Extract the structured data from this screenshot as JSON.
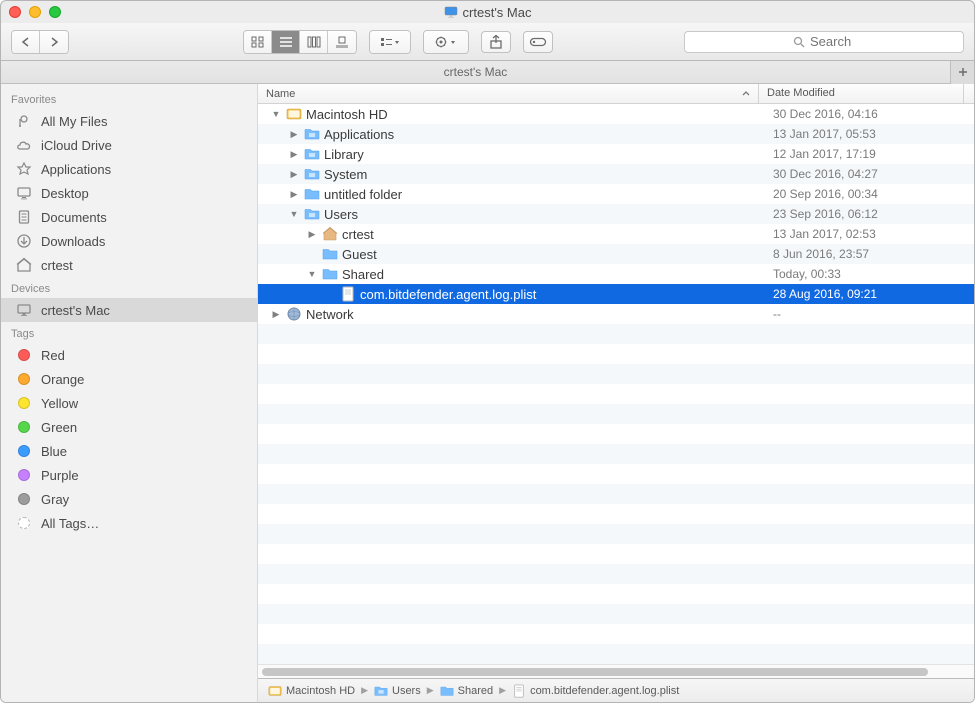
{
  "window": {
    "title": "crtest's Mac",
    "tab_title": "crtest's Mac"
  },
  "search": {
    "placeholder": "Search"
  },
  "sidebar": {
    "favorites_header": "Favorites",
    "favorites": [
      {
        "label": "All My Files",
        "icon": "all-files"
      },
      {
        "label": "iCloud Drive",
        "icon": "icloud"
      },
      {
        "label": "Applications",
        "icon": "applications"
      },
      {
        "label": "Desktop",
        "icon": "desktop"
      },
      {
        "label": "Documents",
        "icon": "documents"
      },
      {
        "label": "Downloads",
        "icon": "downloads"
      },
      {
        "label": "crtest",
        "icon": "home"
      }
    ],
    "devices_header": "Devices",
    "devices": [
      {
        "label": "crtest's Mac",
        "icon": "imac",
        "active": true
      }
    ],
    "tags_header": "Tags",
    "tags": [
      {
        "label": "Red",
        "color": "#fc5b57"
      },
      {
        "label": "Orange",
        "color": "#fdaa2e"
      },
      {
        "label": "Yellow",
        "color": "#fde52e"
      },
      {
        "label": "Green",
        "color": "#56d74b"
      },
      {
        "label": "Blue",
        "color": "#3a9cff"
      },
      {
        "label": "Purple",
        "color": "#c680ff"
      },
      {
        "label": "Gray",
        "color": "#9c9c9c"
      },
      {
        "label": "All Tags…",
        "color": ""
      }
    ]
  },
  "columns": {
    "name": "Name",
    "date": "Date Modified"
  },
  "rows": [
    {
      "indent": 0,
      "disc": "down",
      "icon": "hd",
      "name": "Macintosh HD",
      "date": "30 Dec 2016, 04:16",
      "sel": false
    },
    {
      "indent": 1,
      "disc": "right",
      "icon": "sysfolder",
      "name": "Applications",
      "date": "13 Jan 2017, 05:53",
      "sel": false
    },
    {
      "indent": 1,
      "disc": "right",
      "icon": "sysfolder",
      "name": "Library",
      "date": "12 Jan 2017, 17:19",
      "sel": false
    },
    {
      "indent": 1,
      "disc": "right",
      "icon": "sysfolder",
      "name": "System",
      "date": "30 Dec 2016, 04:27",
      "sel": false
    },
    {
      "indent": 1,
      "disc": "right",
      "icon": "folder",
      "name": "untitled folder",
      "date": "20 Sep 2016, 00:34",
      "sel": false
    },
    {
      "indent": 1,
      "disc": "down",
      "icon": "sysfolder",
      "name": "Users",
      "date": "23 Sep 2016, 06:12",
      "sel": false
    },
    {
      "indent": 2,
      "disc": "right",
      "icon": "home",
      "name": "crtest",
      "date": "13 Jan 2017, 02:53",
      "sel": false
    },
    {
      "indent": 2,
      "disc": "none",
      "icon": "folder",
      "name": "Guest",
      "date": "8 Jun 2016, 23:57",
      "sel": false
    },
    {
      "indent": 2,
      "disc": "down",
      "icon": "folder",
      "name": "Shared",
      "date": "Today, 00:33",
      "sel": false
    },
    {
      "indent": 3,
      "disc": "none",
      "icon": "plist",
      "name": "com.bitdefender.agent.log.plist",
      "date": "28 Aug 2016, 09:21",
      "sel": true
    },
    {
      "indent": 0,
      "disc": "right",
      "icon": "network",
      "name": "Network",
      "date": "--",
      "sel": false
    }
  ],
  "pathbar": [
    {
      "icon": "hd",
      "label": "Macintosh HD"
    },
    {
      "icon": "sysfolder",
      "label": "Users"
    },
    {
      "icon": "folder",
      "label": "Shared"
    },
    {
      "icon": "plist",
      "label": "com.bitdefender.agent.log.plist"
    }
  ]
}
